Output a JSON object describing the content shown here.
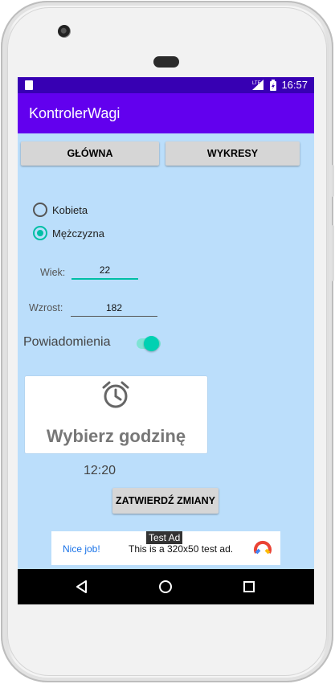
{
  "status_bar": {
    "time": "16:57",
    "network": "LTE"
  },
  "app": {
    "title": "KontrolerWagi"
  },
  "nav_buttons": {
    "main": "GŁÓWNA",
    "charts": "WYKRESY"
  },
  "gender": {
    "female": "Kobieta",
    "male": "Mężczyzna",
    "selected": "male"
  },
  "age": {
    "label": "Wiek:",
    "value": "22"
  },
  "height": {
    "label": "Wzrost:",
    "value": "182"
  },
  "notifications": {
    "label": "Powiadomienia",
    "enabled": true
  },
  "reminder": {
    "card_label": "Wybierz godzinę",
    "time": "12:20"
  },
  "confirm_button": "ZATWIERDŹ ZMIANY",
  "ad": {
    "badge": "Test Ad",
    "nice_job": "Nice job!",
    "text": "This is a 320x50 test ad."
  },
  "colors": {
    "status_bar": "#3700b3",
    "app_bar": "#6200ee",
    "accent": "#00bfa5",
    "background": "#bbdefb"
  },
  "icons": [
    "sd-card-icon",
    "signal-icon",
    "battery-icon",
    "alarm-clock-icon",
    "ad-logo-icon",
    "back-icon",
    "home-icon",
    "recents-icon"
  ]
}
